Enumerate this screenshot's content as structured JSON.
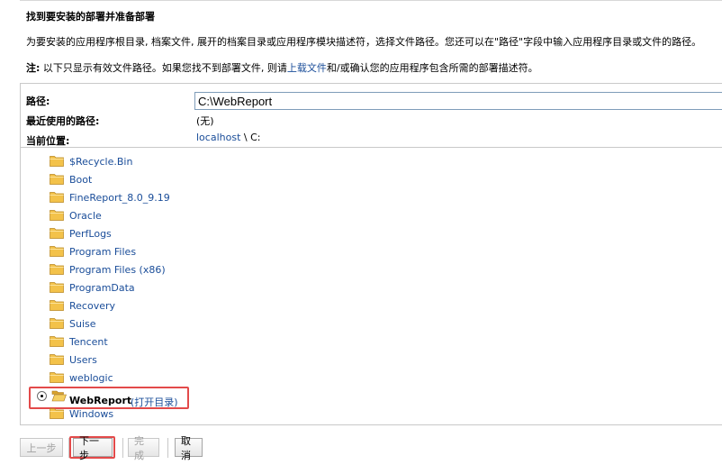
{
  "heading": "找到要安装的部署并准备部署",
  "description": "为要安装的应用程序根目录, 档案文件, 展开的档案目录或应用程序模块描述符，选择文件路径。您还可以在\"路径\"字段中输入应用程序目录或文件的路径。",
  "note": {
    "prefix": "注:",
    "text_before_link": " 以下只显示有效文件路径。如果您找不到部署文件, 则请",
    "link": "上载文件",
    "text_after_link": "和/或确认您的应用程序包含所需的部署描述符。"
  },
  "path_field": {
    "label": "路径:",
    "value": "C:\\WebReport"
  },
  "recent_paths": {
    "label": "最近使用的路径:",
    "value": "(无)"
  },
  "current_location": {
    "label": "当前位置:",
    "host_link": "localhost",
    "separator": " \\ ",
    "drive": "C:"
  },
  "folders": [
    "$Recycle.Bin",
    "Boot",
    "FineReport_8.0_9.19",
    "Oracle",
    "PerfLogs",
    "Program Files",
    "Program Files (x86)",
    "ProgramData",
    "Recovery",
    "Suise",
    "Tencent",
    "Users",
    "weblogic"
  ],
  "selected_folder": {
    "name": "WebReport",
    "open_link": "(打开目录)"
  },
  "folder_after": "Windows",
  "buttons": {
    "back": "上一步",
    "next": "下一步",
    "finish": "完成",
    "cancel": "取消"
  },
  "colors": {
    "link": "#1a4d99",
    "highlight": "#e34a4a",
    "folder": "#f3c24a"
  }
}
